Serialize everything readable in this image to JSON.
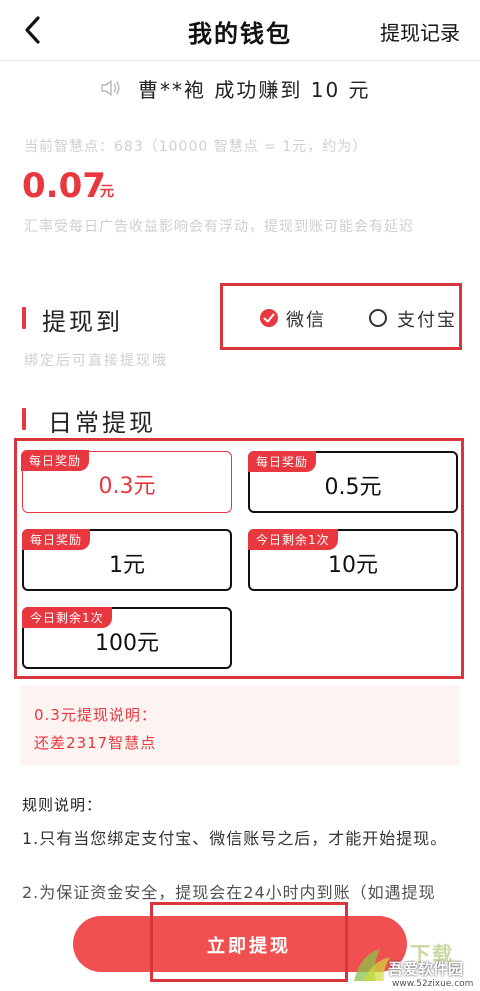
{
  "header": {
    "back_icon": "chevron-left-icon",
    "title": "我的钱包",
    "records_label": "提现记录"
  },
  "marquee": {
    "icon": "speaker-icon",
    "text": "曹**袍  成功赚到 10 元"
  },
  "balance": {
    "points_text": "当前智慧点：683（10000 智慧点 = 1元，约为）",
    "amount": "0.07",
    "unit": "元",
    "notice": "汇率受每日广告收益影响会有浮动，提现到账可能会有延迟"
  },
  "withdraw_to": {
    "title": "提现到",
    "hint": "绑定后可直接提现哦",
    "options": [
      {
        "label": "微信",
        "selected": true
      },
      {
        "label": "支付宝",
        "selected": false
      }
    ]
  },
  "daily": {
    "title": "日常提现",
    "options": [
      {
        "badge": "每日奖励",
        "value": "0.3元",
        "selected": true
      },
      {
        "badge": "每日奖励",
        "value": "0.5元",
        "selected": false
      },
      {
        "badge": "每日奖励",
        "value": "1元",
        "selected": false
      },
      {
        "badge": "今日剩余1次",
        "value": "10元",
        "selected": false
      },
      {
        "badge": "今日剩余1次",
        "value": "100元",
        "selected": false
      }
    ]
  },
  "explain": {
    "line1": "0.3元提现说明：",
    "line2": "还差2317智慧点"
  },
  "rules": {
    "title": "规则说明：",
    "item1": "1.只有当您绑定支付宝、微信账号之后，才能开始提现。",
    "item2": "2.为保证资金安全，提现会在24小时内到账（如遇提现"
  },
  "submit": {
    "label": "立即提现"
  },
  "watermark": {
    "name": "吾爱软件园",
    "url": "www.52zixue.com",
    "text": "下载"
  },
  "colors": {
    "accent": "#e8373f",
    "highlight_border": "#d9353d",
    "button": "#f05050",
    "explain_bg": "#fdf3f1"
  }
}
